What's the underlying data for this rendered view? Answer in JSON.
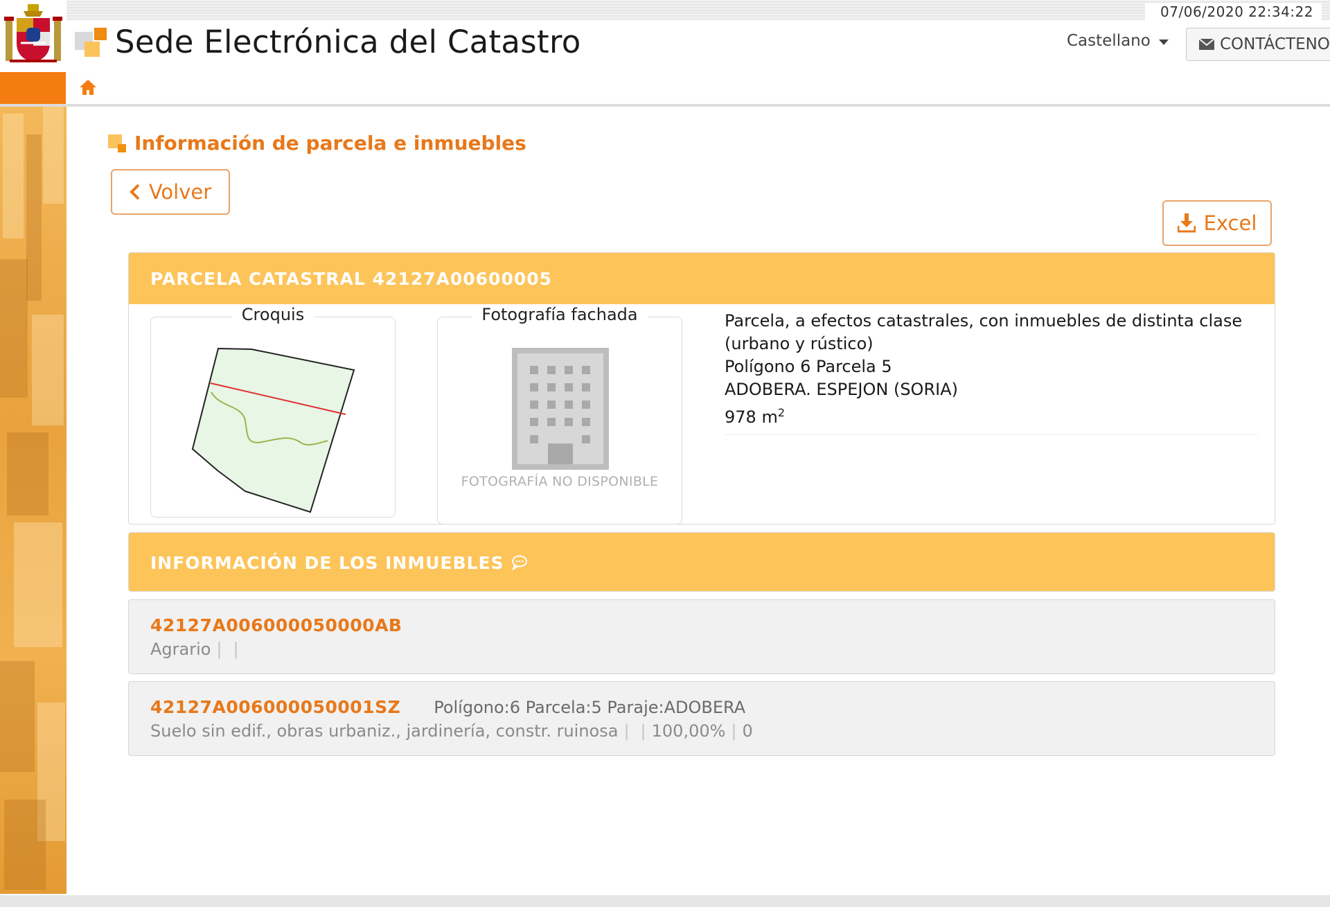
{
  "header": {
    "datetime": "07/06/2020  22:34:22",
    "site_title": "Sede Electrónica del Catastro",
    "language": "Castellano",
    "contact_label": "CONTÁCTENO"
  },
  "page": {
    "title": "Información de parcela e inmuebles",
    "back_label": "Volver",
    "excel_label": "Excel"
  },
  "parcela": {
    "heading": "PARCELA CATASTRAL 42127A00600005",
    "croquis_label": "Croquis",
    "foto_label": "Fotografía fachada",
    "foto_unavailable": "FOTOGRAFÍA NO DISPONIBLE",
    "info": {
      "line1": "Parcela, a efectos catastrales, con inmuebles de distinta clase",
      "line2": "(urbano y rústico)",
      "line3": "Polígono 6 Parcela 5",
      "line4": "ADOBERA. ESPEJON (SORIA)",
      "area": "978 m",
      "area_unit_sup": "2"
    }
  },
  "inmuebles": {
    "heading": "INFORMACIÓN DE LOS INMUEBLES",
    "items": [
      {
        "ref": "42127A006000050000AB",
        "extra": "",
        "desc": "Agrario",
        "sep1": "|",
        "sep2": "|"
      },
      {
        "ref": "42127A006000050001SZ",
        "extra": "Polígono:6 Parcela:5 Paraje:ADOBERA",
        "desc": "Suelo sin edif., obras urbaniz., jardinería, constr. ruinosa",
        "sep1": "|",
        "sep2": "|",
        "percent": "100,00%",
        "sep3": "|",
        "count": "0"
      }
    ]
  },
  "colors": {
    "accent_orange": "#e8781a",
    "panel_yellow": "#fdc45a",
    "nav_orange": "#f57c10"
  },
  "icons": [
    "spain-crest-icon",
    "catastro-logo-icon",
    "caret-down-icon",
    "envelope-icon",
    "home-icon",
    "chevron-left-icon",
    "download-icon",
    "comment-icon",
    "building-placeholder-icon"
  ]
}
